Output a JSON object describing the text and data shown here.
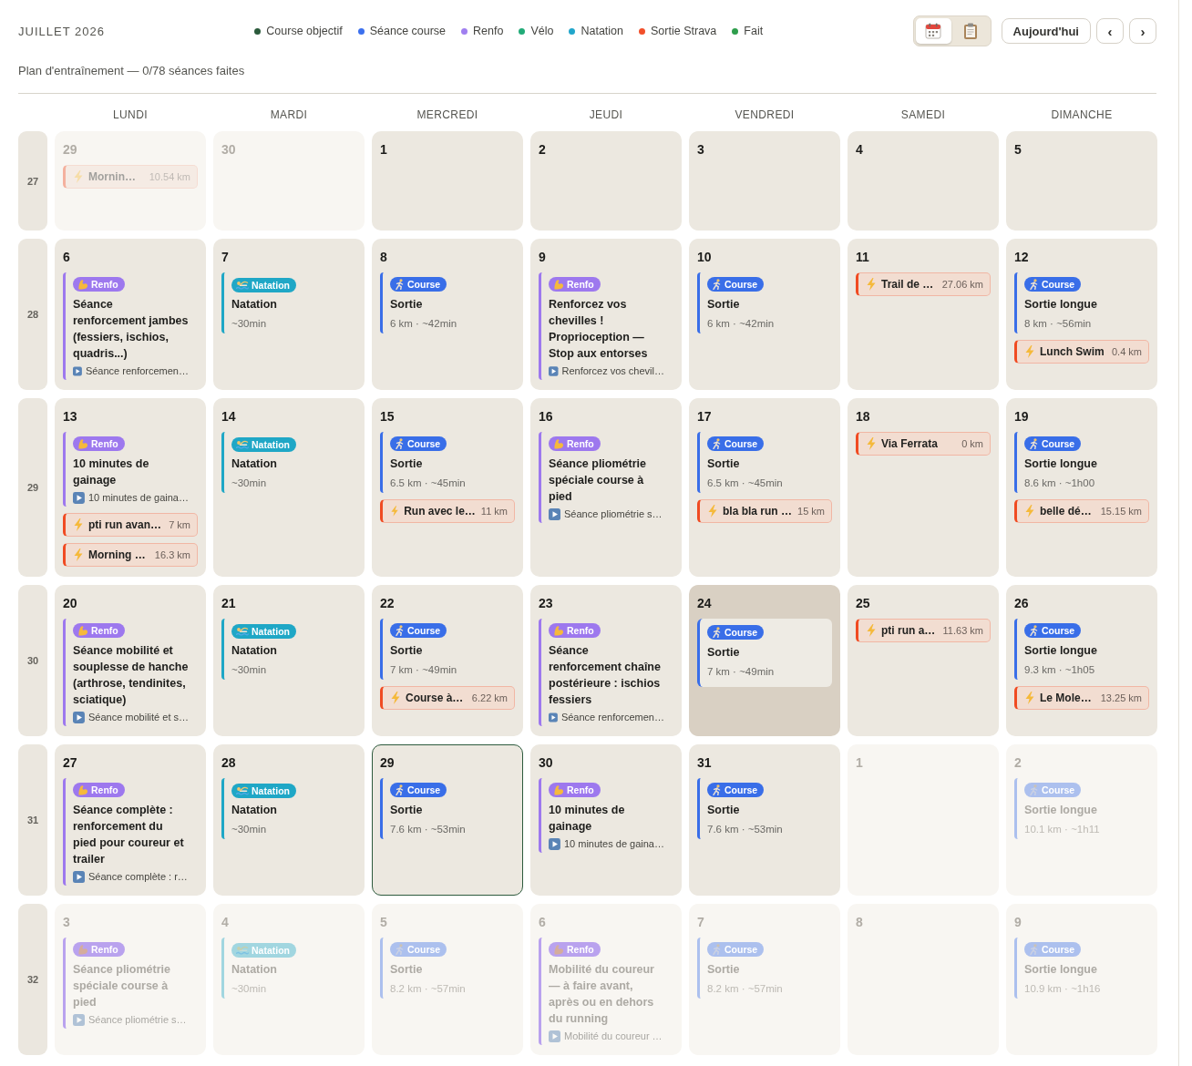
{
  "header": {
    "title": "JUILLET 2026",
    "legend": [
      {
        "label": "Course objectif",
        "color": "#2b5a3b"
      },
      {
        "label": "Séance course",
        "color": "#3c70ee"
      },
      {
        "label": "Renfo",
        "color": "#a07ff0"
      },
      {
        "label": "Vélo",
        "color": "#22ab78"
      },
      {
        "label": "Natation",
        "color": "#21a6cb"
      },
      {
        "label": "Sortie Strava",
        "color": "#f24f2a"
      },
      {
        "label": "Fait",
        "color": "#2e9e4c"
      }
    ],
    "views": [
      {
        "kind": "calendar",
        "selected": true
      },
      {
        "kind": "clipboard",
        "selected": false
      }
    ],
    "today_button": "Aujourd'hui",
    "prev_button": "‹",
    "next_button": "›"
  },
  "subtitle": "Plan d'entraînement — 0/78 séances faites",
  "weekdays": [
    "LUNDI",
    "MARDI",
    "MERCREDI",
    "JEUDI",
    "VENDREDI",
    "SAMEDI",
    "DIMANCHE"
  ],
  "weeks": [
    {
      "number": "27",
      "days": [
        {
          "date": "29",
          "in_month": false,
          "selected": false,
          "today": false,
          "items": [
            {
              "kind": "strava",
              "name": "Mornin…",
              "distance": "10.54 km"
            }
          ]
        },
        {
          "date": "30",
          "in_month": false,
          "selected": false,
          "today": false
        },
        {
          "date": "1",
          "in_month": true,
          "selected": false,
          "today": false
        },
        {
          "date": "2",
          "in_month": true,
          "selected": false,
          "today": false
        },
        {
          "date": "3",
          "in_month": true,
          "selected": false,
          "today": false
        },
        {
          "date": "4",
          "in_month": true,
          "selected": false,
          "today": false
        },
        {
          "date": "5",
          "in_month": true,
          "selected": false,
          "today": false
        }
      ]
    },
    {
      "number": "28",
      "days": [
        {
          "date": "6",
          "in_month": true,
          "selected": false,
          "today": false,
          "items": [
            {
              "kind": "renfo",
              "tag": "Renfo",
              "color": "#9d78ee",
              "title": "Séance renforcement jambes (fessiers, ischios, quadris...)",
              "video": "Séance renforcemen…"
            }
          ]
        },
        {
          "date": "7",
          "in_month": true,
          "selected": false,
          "today": false,
          "items": [
            {
              "kind": "natation",
              "tag": "Natation",
              "color": "#1fa7c6",
              "title": "Natation",
              "meta": "~30min"
            }
          ]
        },
        {
          "date": "8",
          "in_month": true,
          "selected": false,
          "today": false,
          "items": [
            {
              "kind": "course",
              "tag": "Course",
              "color": "#396ee8",
              "title": "Sortie",
              "meta": "6 km · ~42min"
            }
          ]
        },
        {
          "date": "9",
          "in_month": true,
          "selected": false,
          "today": false,
          "items": [
            {
              "kind": "renfo",
              "tag": "Renfo",
              "color": "#9d78ee",
              "title": "Renforcez vos chevilles ! Proprioception — Stop aux entorses",
              "video": "Renforcez vos chevil…"
            }
          ]
        },
        {
          "date": "10",
          "in_month": true,
          "selected": false,
          "today": false,
          "items": [
            {
              "kind": "course",
              "tag": "Course",
              "color": "#396ee8",
              "title": "Sortie",
              "meta": "6 km · ~42min"
            }
          ]
        },
        {
          "date": "11",
          "in_month": true,
          "selected": false,
          "today": false,
          "items": [
            {
              "kind": "strava",
              "name": "Trail de …",
              "distance": "27.06 km"
            }
          ]
        },
        {
          "date": "12",
          "in_month": true,
          "selected": false,
          "today": false,
          "items": [
            {
              "kind": "course",
              "tag": "Course",
              "color": "#396ee8",
              "title": "Sortie longue",
              "meta": "8 km · ~56min"
            },
            {
              "kind": "strava",
              "name": "Lunch Swim",
              "distance": "0.4 km"
            }
          ]
        }
      ]
    },
    {
      "number": "29",
      "days": [
        {
          "date": "13",
          "in_month": true,
          "selected": false,
          "today": false,
          "items": [
            {
              "kind": "renfo",
              "tag": "Renfo",
              "color": "#9d78ee",
              "title": "10 minutes de gainage",
              "video": "10 minutes de gaina…"
            },
            {
              "kind": "strava",
              "name": "pti run avan…",
              "distance": "7 km"
            },
            {
              "kind": "strava",
              "name": "Morning …",
              "distance": "16.3 km"
            }
          ]
        },
        {
          "date": "14",
          "in_month": true,
          "selected": false,
          "today": false,
          "items": [
            {
              "kind": "natation",
              "tag": "Natation",
              "color": "#1fa7c6",
              "title": "Natation",
              "meta": "~30min"
            }
          ]
        },
        {
          "date": "15",
          "in_month": true,
          "selected": false,
          "today": false,
          "items": [
            {
              "kind": "course",
              "tag": "Course",
              "color": "#396ee8",
              "title": "Sortie",
              "meta": "6.5 km · ~45min"
            },
            {
              "kind": "strava",
              "name": "Run avec le…",
              "distance": "11 km"
            }
          ]
        },
        {
          "date": "16",
          "in_month": true,
          "selected": false,
          "today": false,
          "items": [
            {
              "kind": "renfo",
              "tag": "Renfo",
              "color": "#9d78ee",
              "title": "Séance pliométrie spéciale course à pied",
              "video": "Séance pliométrie s…"
            }
          ]
        },
        {
          "date": "17",
          "in_month": true,
          "selected": false,
          "today": false,
          "items": [
            {
              "kind": "course",
              "tag": "Course",
              "color": "#396ee8",
              "title": "Sortie",
              "meta": "6.5 km · ~45min"
            },
            {
              "kind": "strava",
              "name": "bla bla run …",
              "distance": "15 km"
            }
          ]
        },
        {
          "date": "18",
          "in_month": true,
          "selected": false,
          "today": false,
          "items": [
            {
              "kind": "strava",
              "name": "Via Ferrata",
              "distance": "0 km"
            }
          ]
        },
        {
          "date": "19",
          "in_month": true,
          "selected": false,
          "today": false,
          "items": [
            {
              "kind": "course",
              "tag": "Course",
              "color": "#396ee8",
              "title": "Sortie longue",
              "meta": "8.6 km · ~1h00"
            },
            {
              "kind": "strava",
              "name": "belle dé…",
              "distance": "15.15 km"
            }
          ]
        }
      ]
    },
    {
      "number": "30",
      "days": [
        {
          "date": "20",
          "in_month": true,
          "selected": false,
          "today": false,
          "items": [
            {
              "kind": "renfo",
              "tag": "Renfo",
              "color": "#9d78ee",
              "title": "Séance mobilité et souplesse de hanche (arthrose, tendinites, sciatique)",
              "video": "Séance mobilité et s…"
            }
          ]
        },
        {
          "date": "21",
          "in_month": true,
          "selected": false,
          "today": false,
          "items": [
            {
              "kind": "natation",
              "tag": "Natation",
              "color": "#1fa7c6",
              "title": "Natation",
              "meta": "~30min"
            }
          ]
        },
        {
          "date": "22",
          "in_month": true,
          "selected": false,
          "today": false,
          "items": [
            {
              "kind": "course",
              "tag": "Course",
              "color": "#396ee8",
              "title": "Sortie",
              "meta": "7 km · ~49min"
            },
            {
              "kind": "strava",
              "name": "Course à…",
              "distance": "6.22 km"
            }
          ]
        },
        {
          "date": "23",
          "in_month": true,
          "selected": false,
          "today": false,
          "items": [
            {
              "kind": "renfo",
              "tag": "Renfo",
              "color": "#9d78ee",
              "title": "Séance renforcement chaîne postérieure : ischios fessiers",
              "video": "Séance renforcemen…"
            }
          ]
        },
        {
          "date": "24",
          "in_month": true,
          "selected": true,
          "today": false,
          "items": [
            {
              "kind": "course",
              "tag": "Course",
              "color": "#396ee8",
              "title": "Sortie",
              "meta": "7 km · ~49min"
            }
          ]
        },
        {
          "date": "25",
          "in_month": true,
          "selected": false,
          "today": false,
          "items": [
            {
              "kind": "strava",
              "name": "pti run a…",
              "distance": "11.63 km"
            }
          ]
        },
        {
          "date": "26",
          "in_month": true,
          "selected": false,
          "today": false,
          "items": [
            {
              "kind": "course",
              "tag": "Course",
              "color": "#396ee8",
              "title": "Sortie longue",
              "meta": "9.3 km · ~1h05"
            },
            {
              "kind": "strava",
              "name": "Le Mole…",
              "distance": "13.25 km"
            }
          ]
        }
      ]
    },
    {
      "number": "31",
      "days": [
        {
          "date": "27",
          "in_month": true,
          "selected": false,
          "today": false,
          "items": [
            {
              "kind": "renfo",
              "tag": "Renfo",
              "color": "#9d78ee",
              "title": "Séance complète : renforcement du pied pour coureur et trailer",
              "video": "Séance complète : r…"
            }
          ]
        },
        {
          "date": "28",
          "in_month": true,
          "selected": false,
          "today": false,
          "items": [
            {
              "kind": "natation",
              "tag": "Natation",
              "color": "#1fa7c6",
              "title": "Natation",
              "meta": "~30min"
            }
          ]
        },
        {
          "date": "29",
          "in_month": true,
          "selected": false,
          "today": true,
          "items": [
            {
              "kind": "course",
              "tag": "Course",
              "color": "#396ee8",
              "title": "Sortie",
              "meta": "7.6 km · ~53min"
            }
          ]
        },
        {
          "date": "30",
          "in_month": true,
          "selected": false,
          "today": false,
          "items": [
            {
              "kind": "renfo",
              "tag": "Renfo",
              "color": "#9d78ee",
              "title": "10 minutes de gainage",
              "video": "10 minutes de gaina…"
            }
          ]
        },
        {
          "date": "31",
          "in_month": true,
          "selected": false,
          "today": false,
          "items": [
            {
              "kind": "course",
              "tag": "Course",
              "color": "#396ee8",
              "title": "Sortie",
              "meta": "7.6 km · ~53min"
            }
          ]
        },
        {
          "date": "1",
          "in_month": false,
          "selected": false,
          "today": false
        },
        {
          "date": "2",
          "in_month": false,
          "selected": false,
          "today": false,
          "items": [
            {
              "kind": "course",
              "tag": "Course",
              "color": "#acc0ee",
              "title": "Sortie longue",
              "meta": "10.1 km · ~1h11"
            }
          ]
        }
      ]
    },
    {
      "number": "32",
      "days": [
        {
          "date": "3",
          "in_month": false,
          "selected": false,
          "today": false,
          "items": [
            {
              "kind": "renfo",
              "tag": "Renfo",
              "color": "#b9a2ee",
              "title": "Séance pliométrie spéciale course à pied",
              "video": "Séance pliométrie s…"
            }
          ]
        },
        {
          "date": "4",
          "in_month": false,
          "selected": false,
          "today": false,
          "items": [
            {
              "kind": "natation",
              "tag": "Natation",
              "color": "#a1d6e0",
              "title": "Natation",
              "meta": "~30min"
            }
          ]
        },
        {
          "date": "5",
          "in_month": false,
          "selected": false,
          "today": false,
          "items": [
            {
              "kind": "course",
              "tag": "Course",
              "color": "#acc0ee",
              "title": "Sortie",
              "meta": "8.2 km · ~57min"
            }
          ]
        },
        {
          "date": "6",
          "in_month": false,
          "selected": false,
          "today": false,
          "items": [
            {
              "kind": "renfo",
              "tag": "Renfo",
              "color": "#b9a2ee",
              "title": "Mobilité du coureur — à faire avant, après ou en dehors du running",
              "video": "Mobilité du coureur …"
            }
          ]
        },
        {
          "date": "7",
          "in_month": false,
          "selected": false,
          "today": false,
          "items": [
            {
              "kind": "course",
              "tag": "Course",
              "color": "#acc0ee",
              "title": "Sortie",
              "meta": "8.2 km · ~57min"
            }
          ]
        },
        {
          "date": "8",
          "in_month": false,
          "selected": false,
          "today": false
        },
        {
          "date": "9",
          "in_month": false,
          "selected": false,
          "today": false,
          "items": [
            {
              "kind": "course",
              "tag": "Course",
              "color": "#acc0ee",
              "title": "Sortie longue",
              "meta": "10.9 km · ~1h16"
            }
          ]
        }
      ]
    }
  ]
}
